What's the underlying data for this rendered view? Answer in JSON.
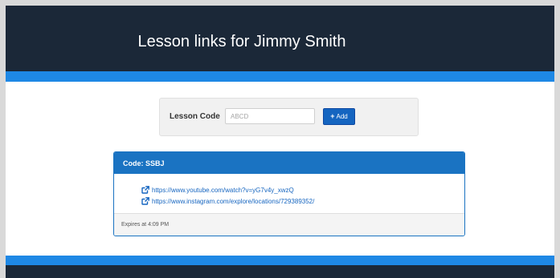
{
  "header": {
    "title": "Lesson links for Jimmy Smith"
  },
  "code_form": {
    "label": "Lesson Code",
    "input_placeholder": "ABCD",
    "input_value": "",
    "add_label": "Add",
    "add_icon": "plus-icon"
  },
  "panel": {
    "title": "Code: SSBJ",
    "links": [
      {
        "icon": "external-link-icon",
        "text": "https://www.youtube.com/watch?v=yG7v4y_xwzQ"
      },
      {
        "icon": "external-link-icon",
        "text": "https://www.instagram.com/explore/locations/729389352/"
      }
    ],
    "footer": "Expires at 4:09 PM"
  },
  "colors": {
    "header_bg": "#1b2838",
    "accent_blue": "#1e88e5",
    "panel_blue": "#1a73c2",
    "button_blue": "#1565c0"
  }
}
